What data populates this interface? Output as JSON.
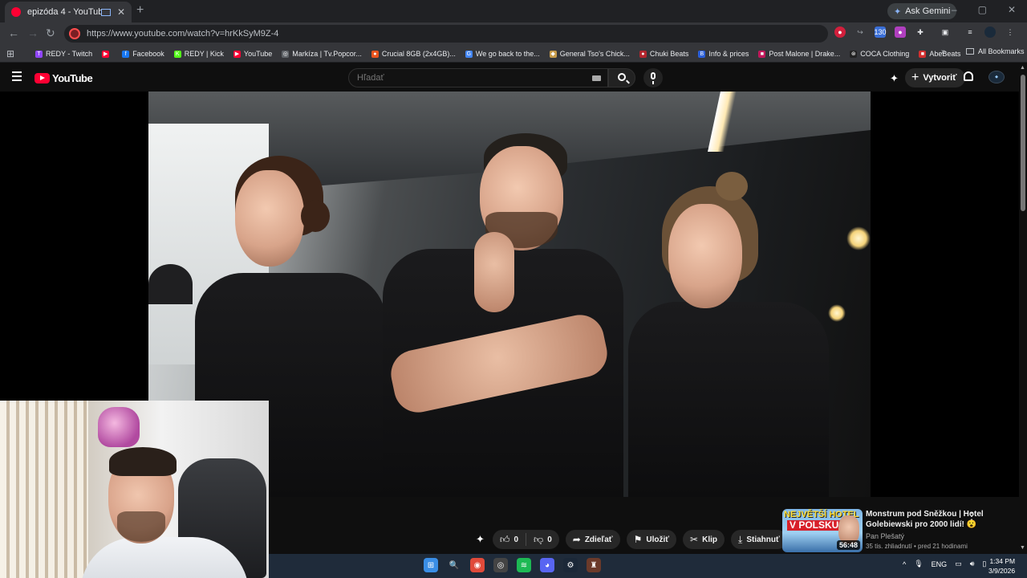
{
  "browser": {
    "tab_title": "epizóda 4 - YouTube",
    "new_tab": "+",
    "gemini_label": "Ask Gemini",
    "url": "https://www.youtube.com/watch?v=hrKkSyM9Z-4",
    "window_controls": [
      "–",
      "▢",
      "✕"
    ],
    "bookmarks": [
      {
        "label": "REDY - Twitch",
        "color": "#9146ff",
        "glyph": "T"
      },
      {
        "label": "",
        "color": "#ff0033",
        "glyph": "▶"
      },
      {
        "label": "Facebook",
        "color": "#1877f2",
        "glyph": "f"
      },
      {
        "label": "REDY | Kick",
        "color": "#53fc18",
        "glyph": "K"
      },
      {
        "label": "YouTube",
        "color": "#ff0033",
        "glyph": "▶"
      },
      {
        "label": "Markíza | Tv.Popcor...",
        "color": "#5f6368",
        "glyph": "◎"
      },
      {
        "label": "Crucial 8GB (2x4GB)...",
        "color": "#e8541e",
        "glyph": "●"
      },
      {
        "label": "We go back to the...",
        "color": "#4285f4",
        "glyph": "G"
      },
      {
        "label": "General Tso's Chick...",
        "color": "#c79b4a",
        "glyph": "◆"
      },
      {
        "label": "Chuki Beats",
        "color": "#b3262e",
        "glyph": "●"
      },
      {
        "label": "Info & prices",
        "color": "#2b5fd9",
        "glyph": "B"
      },
      {
        "label": "Post Malone | Drake...",
        "color": "#c2185b",
        "glyph": "■"
      },
      {
        "label": "COCA Clothing",
        "color": "#222222",
        "glyph": "⊛"
      },
      {
        "label": "AbeBeats",
        "color": "#d32f2f",
        "glyph": "■"
      }
    ],
    "more_bookmarks": "»",
    "all_bookmarks": "All Bookmarks"
  },
  "youtube": {
    "logo_text": "YouTube",
    "search_placeholder": "Hľadať",
    "create_label": "Vytvoriť",
    "actions": {
      "likes": "0",
      "dislikes": "0",
      "share": "Zdieľať",
      "save": "Uložiť",
      "clip": "Klip",
      "download": "Stiahnuť",
      "more": "⋯"
    },
    "recommendation": {
      "title": "Monstrum pod Sněžkou | Hotel Golebiewski pro 2000 lidí! 😮",
      "channel": "Pan Plešatý",
      "stats": "35 tis. zhliadnutí • pred 21 hodinami",
      "duration": "56:48",
      "thumb_headline": "NEJVĚTŠÍ HOTEL",
      "thumb_subline": "V POLSKU",
      "more": "⋮"
    }
  },
  "taskbar": {
    "icons": [
      {
        "name": "windows-start-icon",
        "color": "#3a8ee6",
        "glyph": "⊞"
      },
      {
        "name": "search-icon",
        "color": "transparent",
        "glyph": "🔍"
      },
      {
        "name": "chrome-icon",
        "color": "#e04a3a",
        "glyph": "◉"
      },
      {
        "name": "app-icon",
        "color": "#444444",
        "glyph": "◎"
      },
      {
        "name": "spotify-icon",
        "color": "#1db954",
        "glyph": "≋"
      },
      {
        "name": "discord-icon",
        "color": "#5865f2",
        "glyph": "◕"
      },
      {
        "name": "steam-icon",
        "color": "#1b2838",
        "glyph": "⚙"
      },
      {
        "name": "game-icon",
        "color": "#6b3a2a",
        "glyph": "♜"
      }
    ],
    "tray_chevron": "^",
    "language": "ENG",
    "time": "1:34 PM",
    "date": "3/9/2026"
  }
}
